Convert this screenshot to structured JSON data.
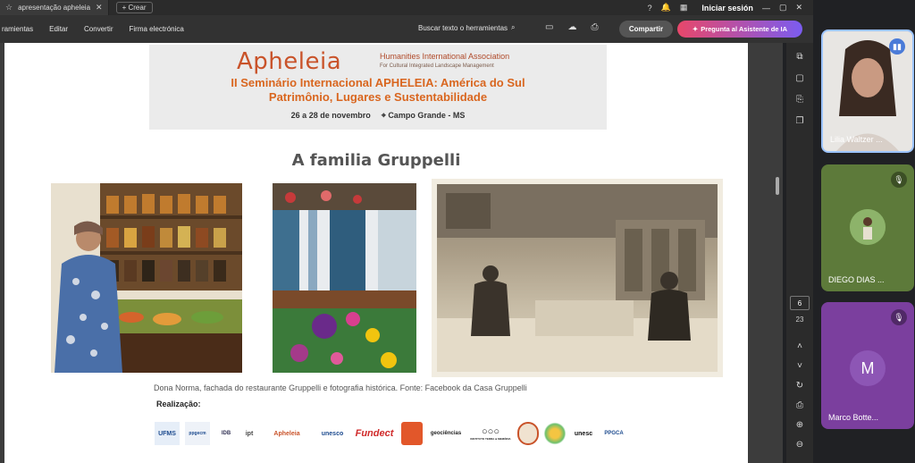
{
  "browser": {
    "tab_title": "apresentação apheleia",
    "new_tab_label": "Crear",
    "login_label": "Iniciar sesión"
  },
  "menu": {
    "items": [
      "ramientas",
      "Editar",
      "Convertir",
      "Firma electrónica"
    ],
    "search_label": "Buscar texto o herramientas",
    "share_label": "Compartir",
    "ai_label": "Pregunta al Asistente de IA"
  },
  "slide": {
    "logo": "Apheleia",
    "assoc_line1": "Humanities International Association",
    "assoc_line2": "For Cultural Integrated Landscape Management",
    "seminar_line1": "II Seminário Internacional APHELEIA: América do Sul",
    "seminar_line2": "Patrimônio, Lugares e Sustentabilidade",
    "dates": "26 a 28 de novembro",
    "location": "Campo Grande - MS",
    "title": "A familia Gruppelli",
    "caption": "Dona Norma, fachada do restaurante Gruppelli e fotografia histórica. Fonte: Facebook da Casa Gruppelli",
    "realizacao": "Realização:",
    "logos": [
      "UFMS",
      "ppgecm",
      "IDB",
      "ipt",
      "Apheleia",
      "unesco",
      "Fundect",
      "",
      "geociências",
      "INSTITUTO TERRA & MEMÓRIA",
      "",
      "",
      "unesc",
      "PPGCA"
    ]
  },
  "viewer": {
    "current_page": "6",
    "total_pages": "23"
  },
  "participants": [
    {
      "name": "Lilia Waltzer ..."
    },
    {
      "name": "DIEGO DIAS ..."
    },
    {
      "name": "Marco Botte...",
      "initial": "M"
    }
  ],
  "colors": {
    "accent_orange": "#d9661f",
    "ai_gradient_start": "#e8476a",
    "ai_gradient_end": "#7b5cf0",
    "active_speaker": "#9cc4ff"
  }
}
